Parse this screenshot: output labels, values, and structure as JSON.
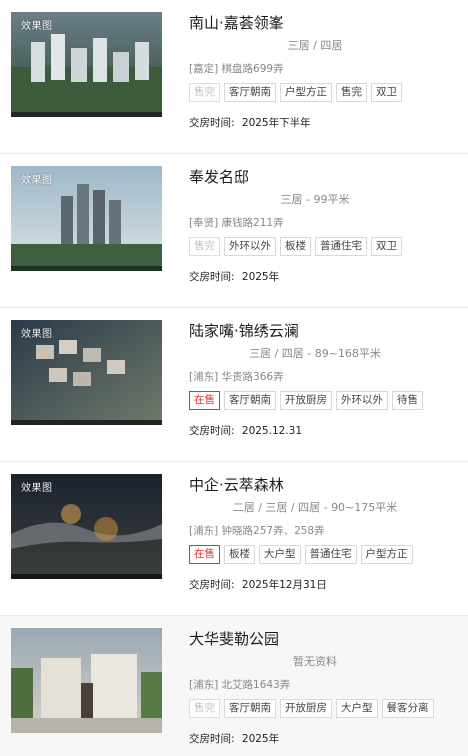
{
  "listings": [
    {
      "badge": "效果图",
      "title": "南山·嘉荟领峯",
      "specs": "三居  / 四居",
      "address": "[嘉定] 棋盘路699弄",
      "tags": [
        {
          "text": "售完",
          "style": "sold"
        },
        {
          "text": "客厅朝南",
          "style": "normal"
        },
        {
          "text": "户型方正",
          "style": "normal"
        },
        {
          "text": "售完",
          "style": "normal"
        },
        {
          "text": "双卫",
          "style": "normal"
        }
      ],
      "delivery_label": "交房时间:",
      "delivery_value": "2025年下半年"
    },
    {
      "badge": "效果图",
      "title": "奉发名邸",
      "specs": "三居    - 99平米",
      "address": "[奉贤] 康钱路211弄",
      "tags": [
        {
          "text": "售完",
          "style": "sold"
        },
        {
          "text": "外环以外",
          "style": "normal"
        },
        {
          "text": "板楼",
          "style": "normal"
        },
        {
          "text": "普通住宅",
          "style": "normal"
        },
        {
          "text": "双卫",
          "style": "normal"
        }
      ],
      "delivery_label": "交房时间:",
      "delivery_value": "2025年"
    },
    {
      "badge": "效果图",
      "title": "陆家嘴·锦绣云澜",
      "specs": "三居  / 四居    - 89~168平米",
      "address": "[浦东] 华贵路366弄",
      "tags": [
        {
          "text": "在售",
          "style": "on"
        },
        {
          "text": "客厅朝南",
          "style": "normal"
        },
        {
          "text": "开放厨房",
          "style": "normal"
        },
        {
          "text": "外环以外",
          "style": "normal"
        },
        {
          "text": "待售",
          "style": "normal"
        }
      ],
      "delivery_label": "交房时间:",
      "delivery_value": "2025.12.31"
    },
    {
      "badge": "效果图",
      "title": "中企·云萃森林",
      "specs": "二居  / 三居  / 四居    - 90~175平米",
      "address": "[浦东] 钟晓路257弄、258弄",
      "tags": [
        {
          "text": "在售",
          "style": "on"
        },
        {
          "text": "板楼",
          "style": "normal"
        },
        {
          "text": "大户型",
          "style": "normal"
        },
        {
          "text": "普通住宅",
          "style": "normal"
        },
        {
          "text": "户型方正",
          "style": "normal"
        }
      ],
      "delivery_label": "交房时间:",
      "delivery_value": "2025年12月31日"
    },
    {
      "badge": "",
      "title": "大华斐勒公园",
      "specs": "暂无资料",
      "address": "[浦东] 北艾路1643弄",
      "tags": [
        {
          "text": "售完",
          "style": "sold"
        },
        {
          "text": "客厅朝南",
          "style": "normal"
        },
        {
          "text": "开放厨房",
          "style": "normal"
        },
        {
          "text": "大户型",
          "style": "normal"
        },
        {
          "text": "餐客分离",
          "style": "normal"
        }
      ],
      "delivery_label": "交房时间:",
      "delivery_value": "2025年"
    }
  ],
  "colors": {
    "on_sale": "#e53333",
    "sold": "#c2c2c2",
    "muted": "#888888"
  }
}
